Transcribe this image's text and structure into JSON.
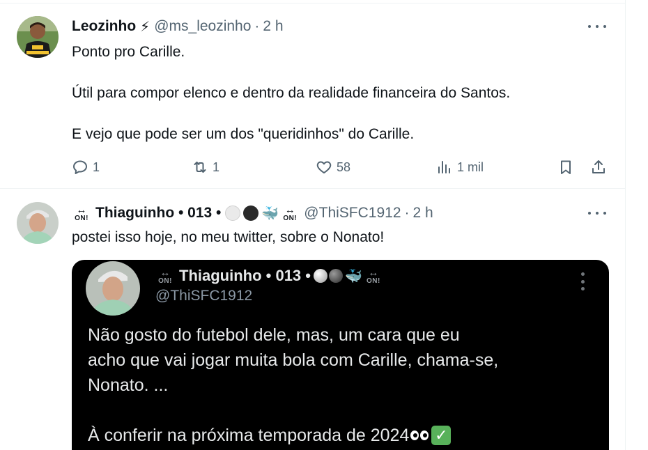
{
  "tweets": [
    {
      "name": "Leozinho",
      "badge_emoji": "⚡",
      "handle": "@ms_leozinho",
      "dot": "·",
      "time": "2 h",
      "lines": [
        "Ponto pro Carille.",
        "Útil para compor elenco e dentro da realidade financeira do Santos.",
        "E vejo que pode ser um dos \"queridinhos\" do Carille."
      ],
      "actions": {
        "reply_count": "1",
        "retweet_count": "1",
        "like_count": "58",
        "views_count": "1 mil"
      }
    },
    {
      "name": "Thiaguinho • 013 •",
      "badge_label": "ON!",
      "badge_arrow": "↔",
      "whale_emoji": "🐳",
      "handle": "@ThiSFC1912",
      "dot": "·",
      "time": "2 h",
      "text": "postei isso hoje, no meu twitter, sobre o Nonato!",
      "media": {
        "name": "Thiaguinho • 013 •",
        "handle": "@ThiSFC1912",
        "whale_emoji": "🐳",
        "lines": [
          "Não gosto do futebol dele, mas, um cara que eu",
          "acho que vai jogar muita bola com Carille, chama-se,",
          "Nonato. ...",
          "À conferir na próxima temporada de 2024"
        ],
        "check_emoji": "✓"
      }
    }
  ],
  "colors": {
    "text": "#0f1419",
    "muted": "#536471",
    "border": "#eff3f4",
    "media_bg": "#000000"
  }
}
